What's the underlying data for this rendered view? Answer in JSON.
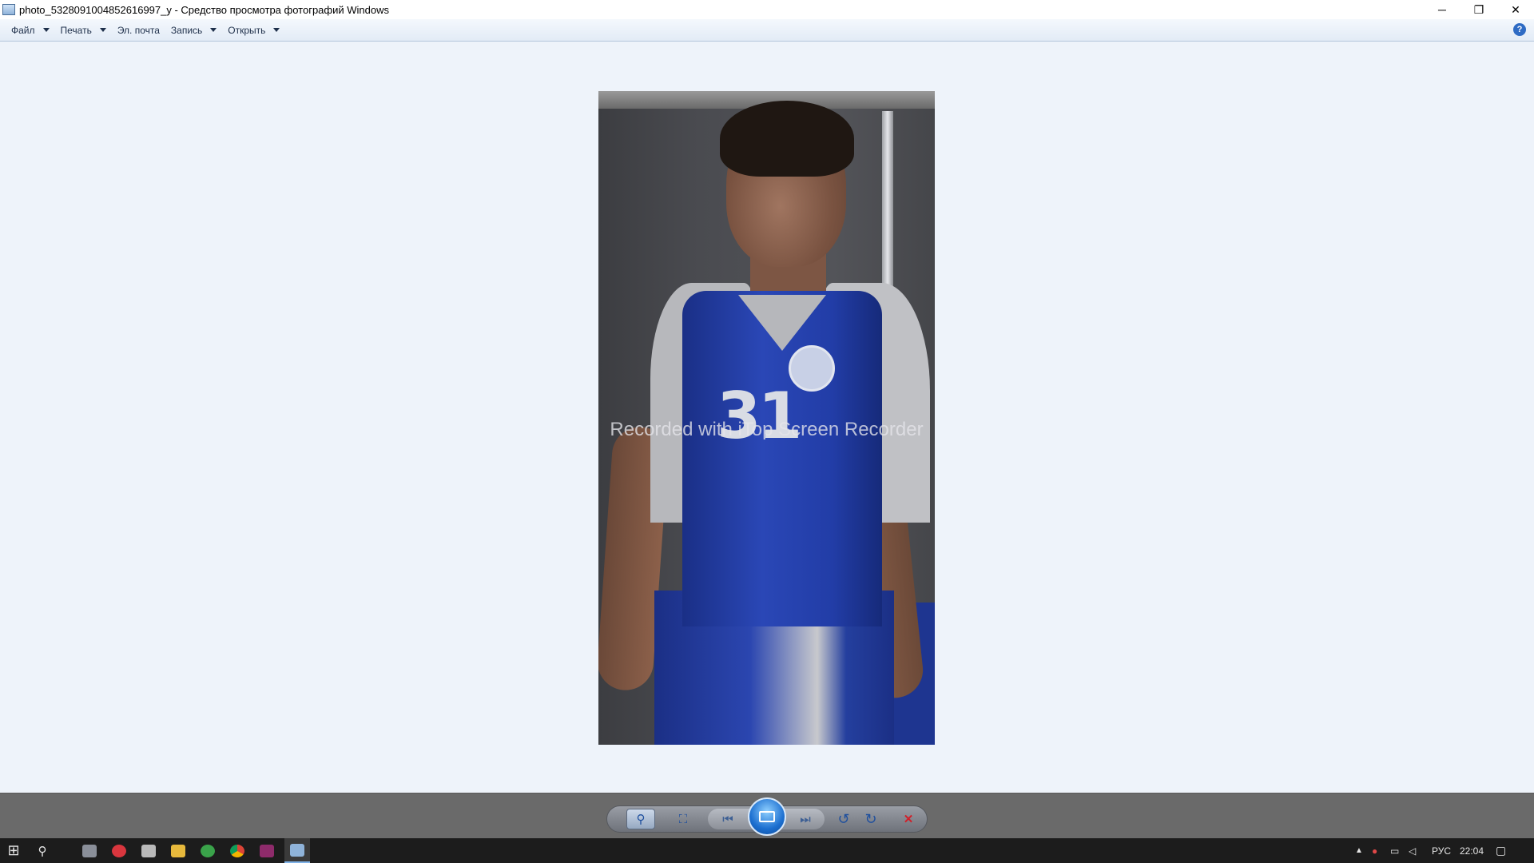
{
  "window": {
    "title": "photo_5328091004852616997_y - Средство просмотра фотографий Windows",
    "controls": {
      "minimize": "─",
      "restore": "❐",
      "close": "✕"
    }
  },
  "menu": {
    "items": [
      {
        "label": "Файл",
        "has_dropdown": true
      },
      {
        "label": "Печать",
        "has_dropdown": true
      },
      {
        "label": "Эл. почта",
        "has_dropdown": false
      },
      {
        "label": "Запись",
        "has_dropdown": true
      },
      {
        "label": "Открыть",
        "has_dropdown": true
      }
    ],
    "help": "?"
  },
  "photo": {
    "jersey_number": "31",
    "watermark": "Recorded with iTop Screen Recorder"
  },
  "controls": {
    "zoom": "⚲",
    "fit": "⛶",
    "previous": "⏮",
    "next": "⏭",
    "rotate_ccw": "↺",
    "rotate_cw": "↻",
    "delete": "✕"
  },
  "taskbar": {
    "start": "⊞",
    "search": "⚲",
    "language": "РУС",
    "time": "22:04"
  },
  "colors": {
    "viewer_bg": "#eef3fa",
    "control_bar": "#6a6a6a",
    "taskbar": "#1c1c1c",
    "accent": "#1c6fd0",
    "delete_red": "#d0202a"
  }
}
